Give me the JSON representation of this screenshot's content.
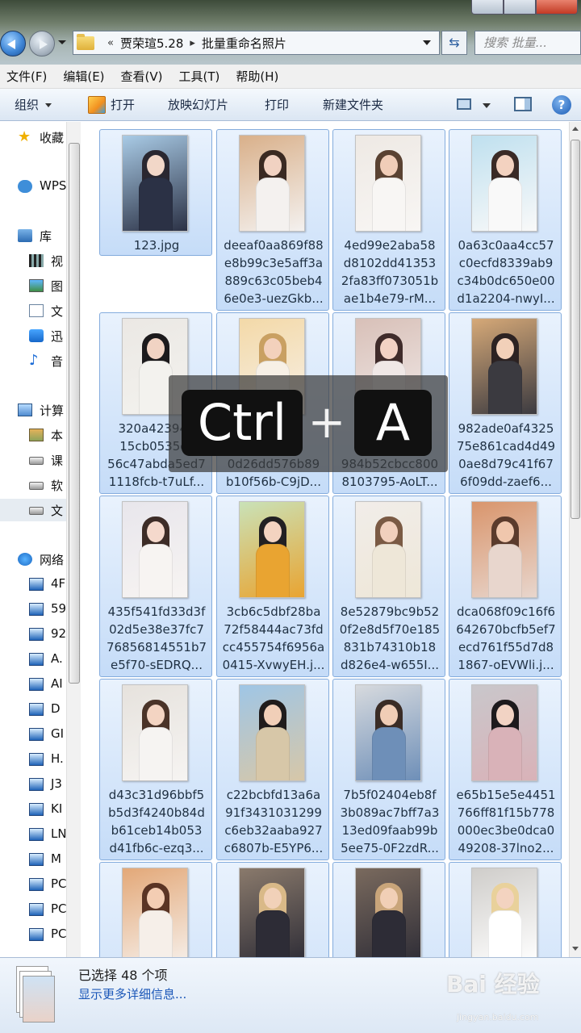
{
  "address": {
    "prefix": "«",
    "crumbs": [
      "贾荣瑄5.28",
      "批量重命名照片"
    ],
    "separator": "▸"
  },
  "search": {
    "placeholder": "搜索 批量..."
  },
  "menu": [
    "文件(F)",
    "编辑(E)",
    "查看(V)",
    "工具(T)",
    "帮助(H)"
  ],
  "toolbar": {
    "organize": "组织",
    "open": "打开",
    "slideshow": "放映幻灯片",
    "print": "打印",
    "new_folder": "新建文件夹",
    "help": "?"
  },
  "nav": [
    {
      "label": "收藏",
      "icon": "star-icon"
    },
    {
      "label": "WPS",
      "icon": "cloud-icon"
    },
    {
      "label": "库",
      "icon": "library-icon"
    },
    {
      "label": "视",
      "icon": "video-icon"
    },
    {
      "label": "图",
      "icon": "picture-icon"
    },
    {
      "label": "文",
      "icon": "document-icon"
    },
    {
      "label": "迅",
      "icon": "thunder-icon"
    },
    {
      "label": "音",
      "icon": "music-icon"
    },
    {
      "label": "计算",
      "icon": "computer-icon"
    },
    {
      "label": "本",
      "icon": "local-disk-icon"
    },
    {
      "label": "课",
      "icon": "drive-icon"
    },
    {
      "label": "软",
      "icon": "drive-icon"
    },
    {
      "label": "文",
      "icon": "drive-icon"
    },
    {
      "label": "网络",
      "icon": "network-icon"
    },
    {
      "label": "4F",
      "icon": "host-icon"
    },
    {
      "label": "59",
      "icon": "host-icon"
    },
    {
      "label": "92",
      "icon": "host-icon"
    },
    {
      "label": "A.",
      "icon": "host-icon"
    },
    {
      "label": "AI",
      "icon": "host-icon"
    },
    {
      "label": "D",
      "icon": "host-icon"
    },
    {
      "label": "GI",
      "icon": "host-icon"
    },
    {
      "label": "H.",
      "icon": "host-icon"
    },
    {
      "label": "J3",
      "icon": "host-icon"
    },
    {
      "label": "KI",
      "icon": "host-icon"
    },
    {
      "label": "LN",
      "icon": "host-icon"
    },
    {
      "label": "M",
      "icon": "host-icon"
    },
    {
      "label": "PC",
      "icon": "host-icon"
    },
    {
      "label": "PC",
      "icon": "host-icon"
    },
    {
      "label": "PC",
      "icon": "host-icon"
    }
  ],
  "files": [
    {
      "name": "123.jpg",
      "palette": [
        "#a9cbe6",
        "#2a2730",
        "#f2d7c8",
        "#2b3145"
      ]
    },
    {
      "name": "deeaf0aa869f88\ne8b99c3e5aff3a\n889c63c05beb4\n6e0e3-uezGkb...",
      "palette": [
        "#d9b08a",
        "#3a2a22",
        "#f1d2c2",
        "#f4f1ef"
      ]
    },
    {
      "name": "4ed99e2aba58\nd8102dd41353\n2fa83ff073051b\nae1b4e79-rM...",
      "palette": [
        "#eee9e4",
        "#5a4232",
        "#f0cdb8",
        "#f8f6f4"
      ]
    },
    {
      "name": "0a63c0aa4cc57\nc0ecfd8339ab9\nc34b0dc650e00\nd1a2204-nwyI...",
      "palette": [
        "#bfe0ef",
        "#3a2a26",
        "#f3d2c0",
        "#f9f9f9"
      ]
    },
    {
      "name": "320a423946\n15cb0535cc\n56c47abda5ed7\n1118fcb-t7uLf...",
      "palette": [
        "#ebe8e4",
        "#1c1a1c",
        "#f1d3c3",
        "#f3f2ee"
      ]
    },
    {
      "name": "0\nf5\n0d26dd576b89\nb10f56b-C9jD...",
      "palette": [
        "#f3d9a8",
        "#c9a062",
        "#f3d1bc",
        "#f7f0e6"
      ]
    },
    {
      "name": "cc\n0c\n984b52cbcc800\n8103795-AoLT...",
      "palette": [
        "#d8c0b8",
        "#3f2b2a",
        "#f2d2c4",
        "#f0e8e6"
      ]
    },
    {
      "name": "982ade0af4325\n75e861cad4d49\n0ae8d79c41f67\n6f09dd-zaef6...",
      "palette": [
        "#d6a978",
        "#2c2222",
        "#f2d0b9",
        "#3b3a40"
      ]
    },
    {
      "name": "435f541fd33d3f\n02d5e38e37fc7\n76856814551b7\ne5f70-sEDRQ...",
      "palette": [
        "#e8e6ec",
        "#3d2c27",
        "#f5d9cc",
        "#f7f4f2"
      ]
    },
    {
      "name": "3cb6c5dbf28ba\n72f58444ac73fd\ncc455754f6956a\n0415-XvwyEH.j...",
      "palette": [
        "#c9e2b8",
        "#222022",
        "#f3d3c0",
        "#e9a431"
      ]
    },
    {
      "name": "8e52879bc9b52\n0f2e8d5f70e185\n831b74310b18\nd826e4-w655I...",
      "palette": [
        "#f1ede9",
        "#7a5a44",
        "#f1d0bd",
        "#eee7d8"
      ]
    },
    {
      "name": "dca068f09c16f6\n642670bcfb5ef7\necd761f55d7d8\n1867-oEVWli.j...",
      "palette": [
        "#d9956c",
        "#5b3b2c",
        "#f0c7ad",
        "#e8d6cd"
      ]
    },
    {
      "name": "d43c31d96bbf5\nb5d3f4240b84d\nb61ceb14b053\nd41fb6c-ezq3...",
      "palette": [
        "#e6e2dd",
        "#4a3328",
        "#f3d4c2",
        "#f6f4f2"
      ]
    },
    {
      "name": "c22bcbfd13a6a\n91f3431031299\nc6eb32aaba927\nc6807b-E5YP6...",
      "palette": [
        "#9fc6e6",
        "#201c1c",
        "#f1cfb8",
        "#d7c7a8"
      ]
    },
    {
      "name": "7b5f02404eb8f\n3b089ac7bff7a3\n13ed09faab99b\n5ee75-0F2zdR...",
      "palette": [
        "#d7dade",
        "#3a2c26",
        "#f0cdb6",
        "#6e8fb8"
      ]
    },
    {
      "name": "e65b15e5e4451\n766ff81f15b778\n000ec3be0dca0\n49208-37lno2...",
      "palette": [
        "#c9c7cb",
        "#1d1a1d",
        "#f2d3c4",
        "#d9b2b8"
      ]
    },
    {
      "name": "",
      "palette": [
        "#e3a878",
        "#5a3424",
        "#f3cdb3",
        "#f6efe9"
      ]
    },
    {
      "name": "",
      "palette": [
        "#8a7a6c",
        "#d9b988",
        "#f1d1b9",
        "#2d2c36"
      ]
    },
    {
      "name": "",
      "palette": [
        "#7a6a5e",
        "#c9a57a",
        "#f1cfb6",
        "#2d2c36"
      ]
    },
    {
      "name": "",
      "palette": [
        "#cfcdca",
        "#e9d19b",
        "#f3d3c0",
        "#ffffff"
      ]
    }
  ],
  "overlay": {
    "key1": "Ctrl",
    "plus": "+",
    "key2": "A"
  },
  "status": {
    "selected": "已选择 48 个项",
    "details_link": "显示更多详细信息..."
  },
  "watermark": {
    "brand": "Bai 经验",
    "url": "jingyan.baidu.com"
  }
}
